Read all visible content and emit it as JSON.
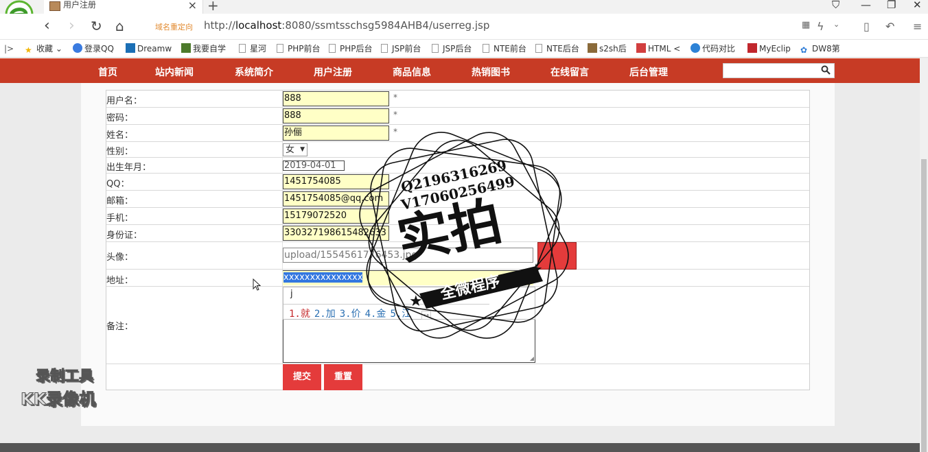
{
  "browser": {
    "tab_title": "用户注册",
    "redirect_label": "域名重定向",
    "url_prefix": "http://",
    "url_host": "localhost",
    "url_rest": ":8080/ssmtsschsg5984AHB4/userreg.jsp",
    "bookmarks": [
      "收藏",
      "登录QQ",
      "Dreamw",
      "我要自学",
      "星河",
      "PHP前台",
      "PHP后台",
      "JSP前台",
      "JSP后台",
      "NTE前台",
      "NTE后台",
      "s2sh后",
      "HTML",
      "代码对比",
      "MyEclip",
      "DW8第"
    ]
  },
  "site_nav": [
    "首页",
    "站内新闻",
    "系统简介",
    "用户注册",
    "商品信息",
    "热销图书",
    "在线留言",
    "后台管理"
  ],
  "search": {
    "placeholder": ""
  },
  "form": {
    "labels": {
      "username": "用户名：",
      "password": "密码：",
      "name": "姓名：",
      "gender": "性别：",
      "birth": "出生年月：",
      "qq": "QQ：",
      "email": "邮箱：",
      "phone": "手机：",
      "idcard": "身份证：",
      "avatar": "头像：",
      "address": "地址：",
      "remark": "备注："
    },
    "values": {
      "username": "888",
      "password": "888",
      "name": "孙俪",
      "gender": "女",
      "birth": "2019-04-01",
      "qq": "1451754085",
      "email": "1451754085@qq.com",
      "phone": "15179072520",
      "idcard": "330327198615482633",
      "avatar": "upload/1554561776453.jpg",
      "address": "xxxxxxxxxxxxxxx"
    },
    "required_mark": "*",
    "submit_label": "提交",
    "reset_label": "重置"
  },
  "ime": {
    "composition": "j",
    "candidates": [
      "1.就",
      "2.加",
      "3.价",
      "4.金",
      "5.江"
    ]
  },
  "stamp": {
    "line1": "Q2196316269",
    "line2": "V17060256499",
    "big": "实拍",
    "ribbon": "全微程序"
  },
  "watermark": {
    "line1": "录制工具",
    "line2": "KK录像机"
  },
  "colors": {
    "nav_bg": "#c73b25",
    "input_bg": "#ffffc6",
    "button_red": "#e43b3b"
  }
}
